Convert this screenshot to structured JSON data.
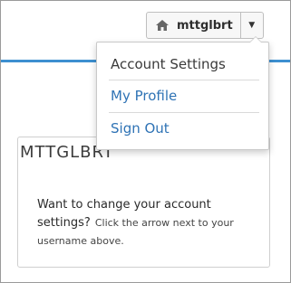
{
  "user": {
    "username": "mttglbrt"
  },
  "icons": {
    "home": "home-icon",
    "caret": "caret-down-icon"
  },
  "dropdown": {
    "header": "Account Settings",
    "items": [
      {
        "label": "My Profile"
      },
      {
        "label": "Sign Out"
      }
    ]
  },
  "card": {
    "title": "MTTGLBRT",
    "prompt_bold": "Want to change your account settings?",
    "prompt_rest": "Click the arrow next to your username above."
  },
  "colors": {
    "accent": "#3d8fd0",
    "link": "#2f73b5"
  }
}
